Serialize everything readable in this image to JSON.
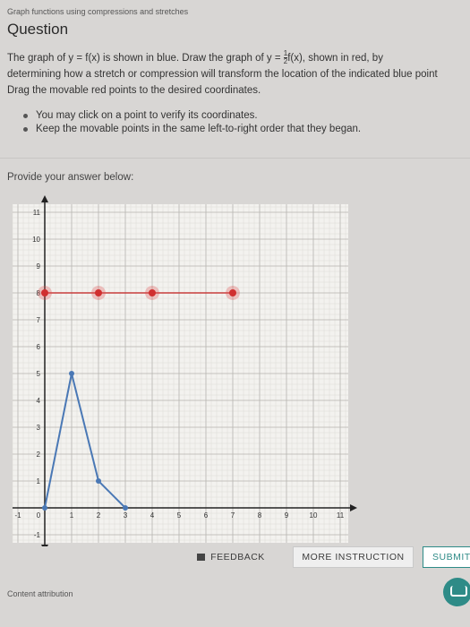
{
  "breadcrumb": "Graph functions using compressions and stretches",
  "title": "Question",
  "question": {
    "line1_prefix": "The graph of y = f(x) is shown in blue. Draw the graph of y = ",
    "frac_num": "1",
    "frac_den": "2",
    "line1_suffix": "f(x), shown in red, by",
    "line2": "determining how a stretch or compression will transform the location of the indicated blue point",
    "line3": "Drag the movable red points to the desired coordinates."
  },
  "bullets": [
    "You may click on a point to verify its coordinates.",
    "Keep the movable points in the same left-to-right order that they began."
  ],
  "provide": "Provide your answer below:",
  "graph": {
    "x_ticks": [
      "-1",
      "0",
      "1",
      "2",
      "3",
      "4",
      "5",
      "6",
      "7",
      "8",
      "9",
      "10",
      "11"
    ],
    "y_ticks": [
      "-1",
      "1",
      "2",
      "3",
      "4",
      "5",
      "6",
      "7",
      "8",
      "9",
      "10",
      "11"
    ],
    "xlim": [
      -1,
      11
    ],
    "ylim": [
      -1,
      11
    ],
    "blue_points": [
      [
        0,
        0
      ],
      [
        1,
        5
      ],
      [
        2,
        1
      ],
      [
        3,
        0
      ]
    ],
    "red_points": [
      [
        0,
        8
      ],
      [
        2,
        8
      ],
      [
        4,
        8
      ],
      [
        7,
        8
      ]
    ],
    "blue_color": "#4a78b5",
    "red_color": "#e05050"
  },
  "buttons": {
    "feedback": "FEEDBACK",
    "instruction": "MORE INSTRUCTION",
    "submit": "SUBMIT"
  },
  "attribution": "Content attribution"
}
